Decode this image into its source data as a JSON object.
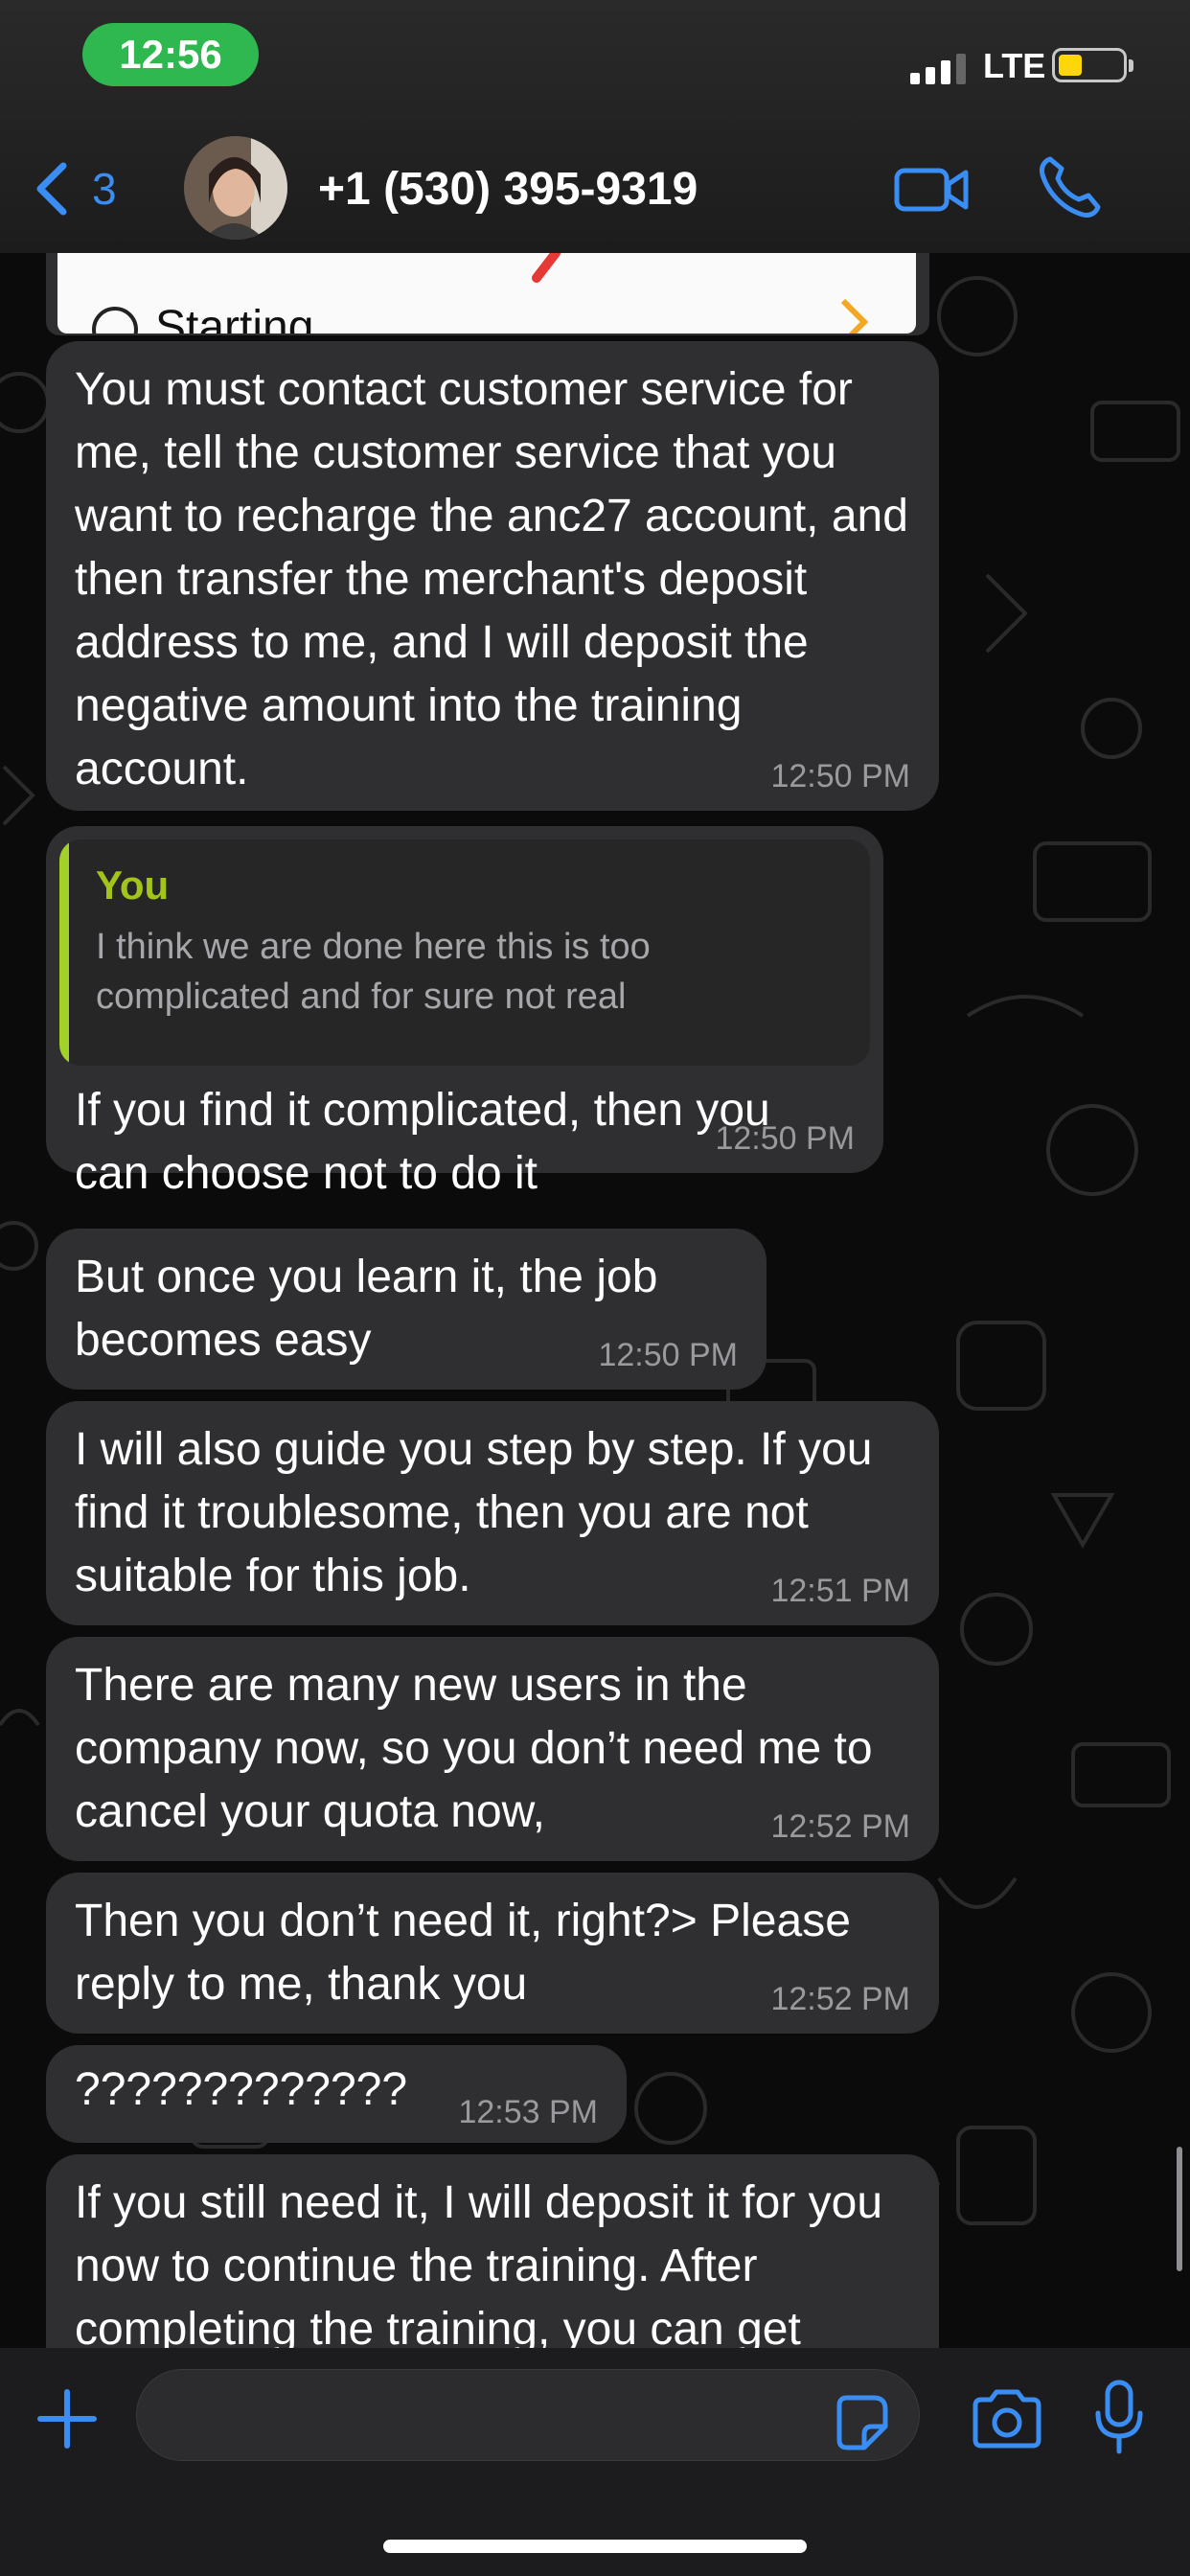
{
  "status_bar": {
    "time": "12:56",
    "network": "LTE"
  },
  "header": {
    "back_count": "3",
    "contact": "+1 (530) 395-9319"
  },
  "attachment_peek": {
    "text": "Starting"
  },
  "messages": [
    {
      "text": "You must contact customer service for me, tell the customer service that you want to recharge the anc27 account, and then transfer the merchant's deposit address to me, and I will deposit the negative amount into the training account.",
      "time": "12:50 PM"
    },
    {
      "quote_author": "You",
      "quote_text": "I think we are done here this is too complicated and for sure not real",
      "text": "If you find it complicated, then you can choose not to do it",
      "time": "12:50 PM"
    },
    {
      "text": "But once you learn it, the job becomes easy",
      "time": "12:50 PM"
    },
    {
      "text": "I will also guide you step by step. If you find it troublesome, then you are not suitable for this job.",
      "time": "12:51 PM"
    },
    {
      "text": "There are many new users in the company now, so you don’t need me to cancel your quota now,",
      "time": "12:52 PM"
    },
    {
      "text": "Then you don’t need it, right?> Please reply to me, thank you",
      "time": "12:52 PM"
    },
    {
      "text": "?????????????",
      "time": "12:53 PM"
    },
    {
      "text": "If you still need it, I will deposit it for you now to continue the training. After completing the training, you can get"
    }
  ],
  "icons": {
    "back": "chevron-left-icon",
    "video": "video-camera-icon",
    "call": "phone-icon",
    "attach": "plus-icon",
    "sticker": "sticker-icon",
    "camera": "camera-icon",
    "mic": "microphone-icon"
  },
  "colors": {
    "accent": "#3a8df2",
    "bubble": "#2f2f31",
    "quote_bar": "#a3d12a",
    "status_pill": "#2fb84f",
    "battery": "#ffd60a"
  }
}
